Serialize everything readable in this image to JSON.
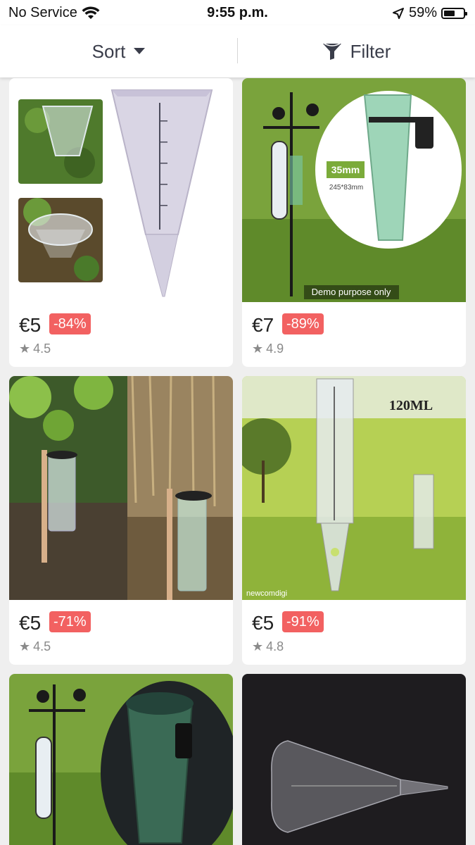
{
  "status": {
    "carrier": "No Service",
    "time": "9:55 p.m.",
    "battery": "59%",
    "battery_level": 0.59
  },
  "toolbar": {
    "sort_label": "Sort",
    "filter_label": "Filter"
  },
  "products": [
    {
      "price": "€5",
      "discount": "-84%",
      "rating": "4.5"
    },
    {
      "price": "€7",
      "discount": "-89%",
      "rating": "4.9",
      "image_caption": "Demo purpose only",
      "size_badge": "35mm",
      "dimensions": "245*83mm"
    },
    {
      "price": "€5",
      "discount": "-71%",
      "rating": "4.5"
    },
    {
      "price": "€5",
      "discount": "-91%",
      "rating": "4.8",
      "image_title": "120ML",
      "watermark": "newcomdigi"
    },
    {
      "price": "",
      "discount": "",
      "rating": ""
    },
    {
      "price": "",
      "discount": "",
      "rating": ""
    }
  ],
  "colors": {
    "discount_bg": "#f26161",
    "grass": "#7aa33c",
    "dark_bg": "#1e1c1f"
  }
}
